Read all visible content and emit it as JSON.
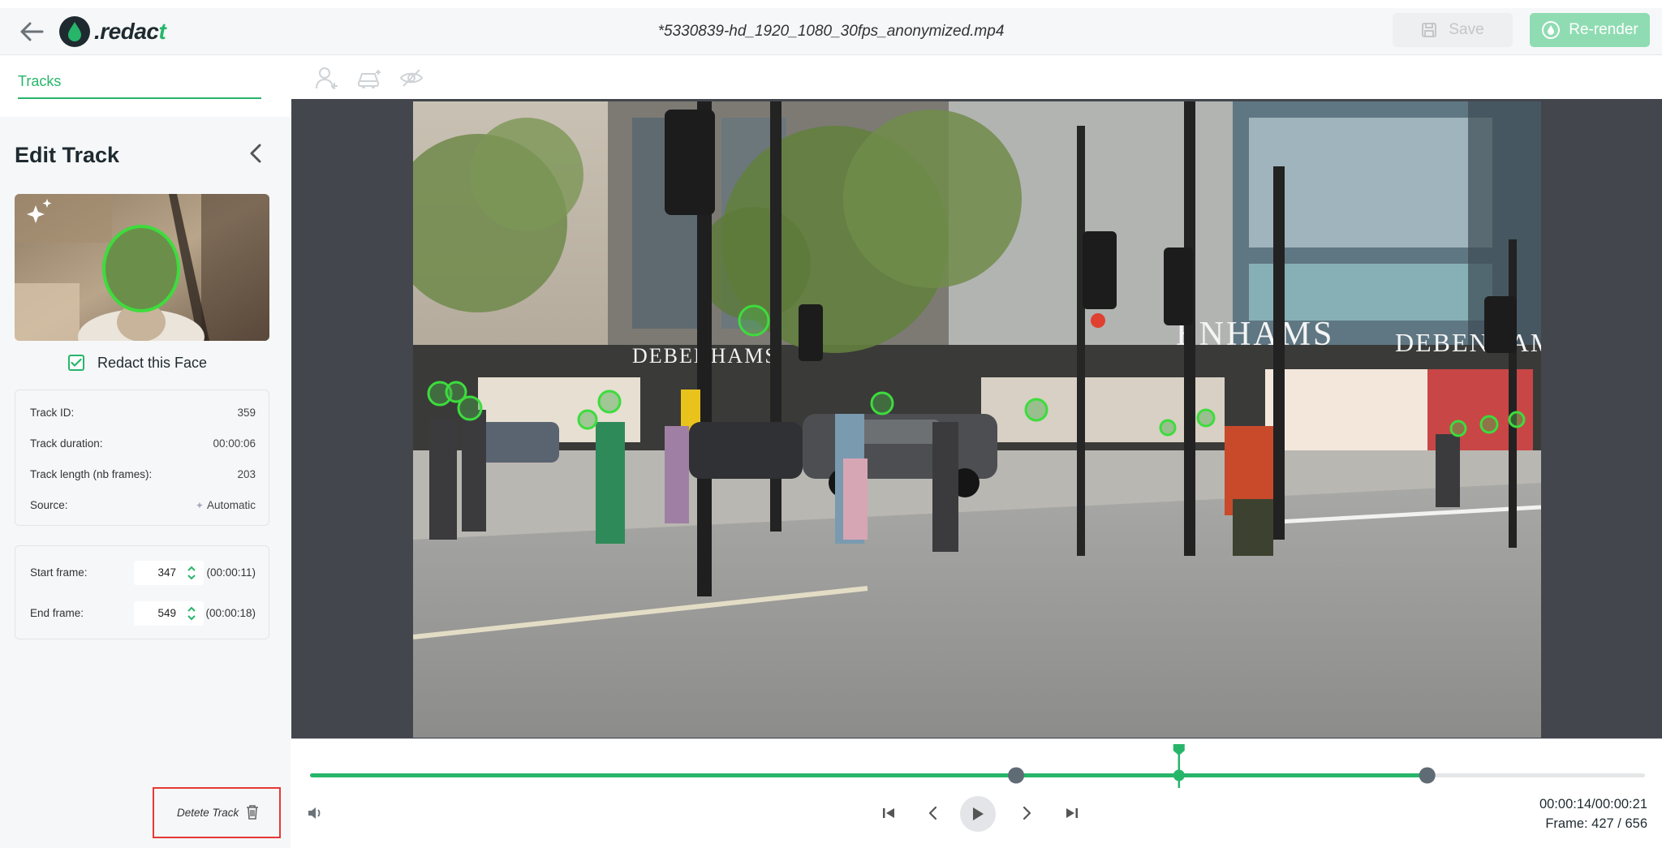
{
  "header": {
    "logo_text_dark": ".redac",
    "logo_text_green": "t",
    "file_name": "*5330839-hd_1920_1080_30fps_anonymized.mp4",
    "save_label": "Save",
    "rerender_label": "Re-render"
  },
  "left_panel": {
    "tab_label": "Tracks",
    "edit_title": "Edit Track",
    "redact_label": "Redact this Face",
    "redact_checked": true,
    "info": {
      "track_id_label": "Track ID:",
      "track_id": "359",
      "duration_label": "Track duration:",
      "duration": "00:00:06",
      "length_label": "Track length (nb frames):",
      "length": "203",
      "source_label": "Source:",
      "source": "Automatic"
    },
    "frames": {
      "start_label": "Start frame:",
      "start_value": "347",
      "start_time": "(00:00:11)",
      "end_label": "End frame:",
      "end_value": "549",
      "end_time": "(00:00:18)"
    },
    "delete_label": "Detete Track"
  },
  "video": {
    "signs": {
      "left": "DEBENHAMS",
      "center": "ENHAMS",
      "right": "DEBENHAMS"
    }
  },
  "player": {
    "time": "00:00:14/00:00:21",
    "frame": "Frame: 427 / 656",
    "current_frame": 427,
    "total_frames": 656,
    "track_start_frame": 347,
    "track_end_frame": 549
  },
  "colors": {
    "accent": "#27b56a",
    "face_ring": "#3ddc3d",
    "delete_outline": "#e53935"
  }
}
